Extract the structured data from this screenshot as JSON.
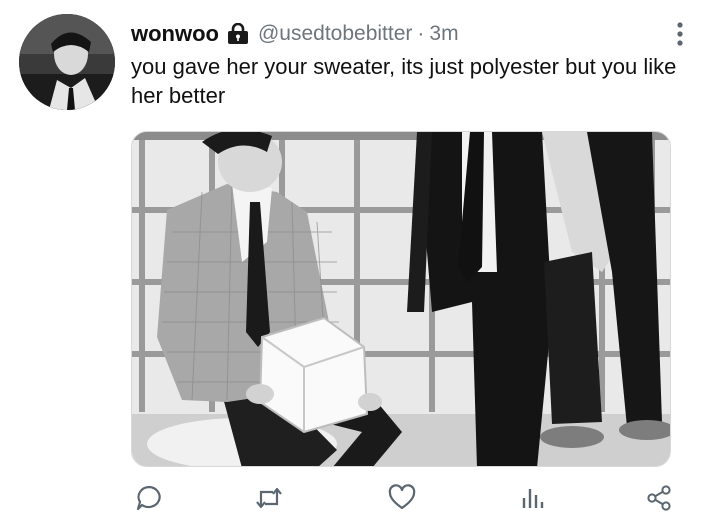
{
  "tweet": {
    "display_name": "wonwoo",
    "handle": "@usedtobebitter",
    "separator": "·",
    "time": "3m",
    "text": "you gave her your sweater, its just polyester but you like her better",
    "protected_icon": "lock-icon"
  },
  "header": {
    "more_icon": "more-vertical-icon"
  },
  "actions": [
    {
      "name": "reply",
      "icon": "comment-icon"
    },
    {
      "name": "retweet",
      "icon": "retweet-icon"
    },
    {
      "name": "like",
      "icon": "heart-icon"
    },
    {
      "name": "analytics",
      "icon": "bar-chart-icon"
    },
    {
      "name": "share",
      "icon": "share-icon"
    }
  ],
  "colors": {
    "text": "#111111",
    "secondary_text": "#6e767d",
    "icon": "#5b6670",
    "background": "#ffffff"
  }
}
